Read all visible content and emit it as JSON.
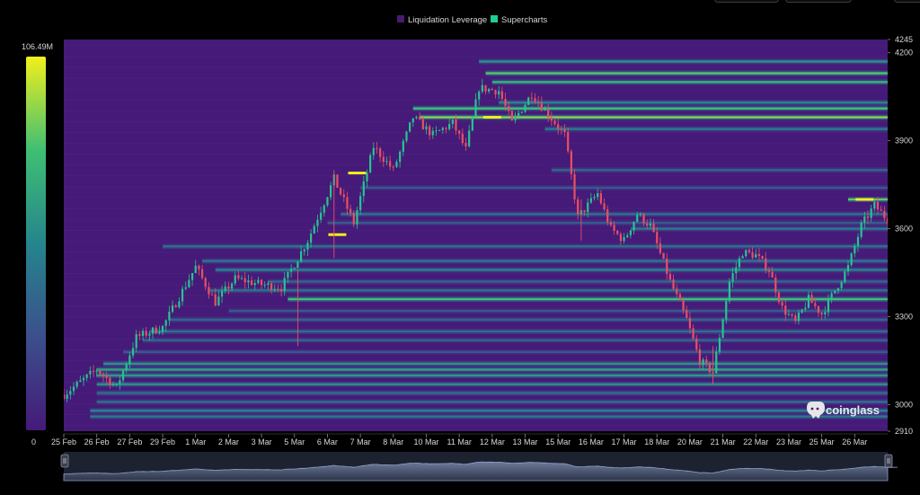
{
  "legend": [
    {
      "label": "Liquidation Leverage",
      "color": "#4a1a6e"
    },
    {
      "label": "Supercharts",
      "color": "#1fcf8f"
    }
  ],
  "colorbar": {
    "max_label": "106.49M",
    "min_label": "0"
  },
  "watermark": "coinglass",
  "colors": {
    "background": "#000000",
    "heat_base": "#451a78",
    "candle_up": "#27c48f",
    "candle_down": "#ea4f64"
  },
  "chart_data": {
    "type": "heatmap",
    "title": "",
    "xlabel": "",
    "ylabel": "",
    "ylim": [
      2910,
      4245
    ],
    "y_ticks": [
      4245,
      4200,
      3900,
      3600,
      3300,
      3000,
      2910
    ],
    "x_ticks": [
      "25 Feb",
      "26 Feb",
      "27 Feb",
      "29 Feb",
      "1 Mar",
      "2 Mar",
      "3 Mar",
      "5 Mar",
      "6 Mar",
      "7 Mar",
      "8 Mar",
      "10 Mar",
      "11 Mar",
      "12 Mar",
      "13 Mar",
      "15 Mar",
      "16 Mar",
      "17 Mar",
      "18 Mar",
      "20 Mar",
      "21 Mar",
      "22 Mar",
      "23 Mar",
      "25 Mar",
      "26 Mar"
    ],
    "colorbar_range": [
      0,
      106.49
    ],
    "colorbar_unit": "M",
    "price_path": [
      {
        "t": 0.0,
        "p": 3035
      },
      {
        "t": 1.0,
        "p": 3120
      },
      {
        "t": 1.6,
        "p": 3060
      },
      {
        "t": 2.2,
        "p": 3230
      },
      {
        "t": 3.0,
        "p": 3265
      },
      {
        "t": 4.0,
        "p": 3470
      },
      {
        "t": 4.6,
        "p": 3350
      },
      {
        "t": 5.2,
        "p": 3430
      },
      {
        "t": 6.0,
        "p": 3410
      },
      {
        "t": 6.6,
        "p": 3400
      },
      {
        "t": 7.4,
        "p": 3560
      },
      {
        "t": 8.2,
        "p": 3770
      },
      {
        "t": 8.8,
        "p": 3620
      },
      {
        "t": 9.4,
        "p": 3880
      },
      {
        "t": 10.0,
        "p": 3800
      },
      {
        "t": 10.6,
        "p": 3980
      },
      {
        "t": 11.2,
        "p": 3920
      },
      {
        "t": 11.8,
        "p": 3960
      },
      {
        "t": 12.2,
        "p": 3870
      },
      {
        "t": 12.6,
        "p": 4080
      },
      {
        "t": 13.2,
        "p": 4070
      },
      {
        "t": 13.6,
        "p": 3960
      },
      {
        "t": 14.2,
        "p": 4060
      },
      {
        "t": 14.7,
        "p": 3990
      },
      {
        "t": 15.2,
        "p": 3920
      },
      {
        "t": 15.6,
        "p": 3640
      },
      {
        "t": 16.2,
        "p": 3720
      },
      {
        "t": 16.6,
        "p": 3600
      },
      {
        "t": 17.0,
        "p": 3560
      },
      {
        "t": 17.4,
        "p": 3650
      },
      {
        "t": 17.8,
        "p": 3610
      },
      {
        "t": 18.4,
        "p": 3420
      },
      {
        "t": 18.9,
        "p": 3290
      },
      {
        "t": 19.3,
        "p": 3150
      },
      {
        "t": 19.7,
        "p": 3110
      },
      {
        "t": 20.2,
        "p": 3420
      },
      {
        "t": 20.6,
        "p": 3520
      },
      {
        "t": 21.0,
        "p": 3510
      },
      {
        "t": 21.4,
        "p": 3460
      },
      {
        "t": 21.8,
        "p": 3330
      },
      {
        "t": 22.2,
        "p": 3280
      },
      {
        "t": 22.6,
        "p": 3360
      },
      {
        "t": 23.0,
        "p": 3310
      },
      {
        "t": 23.4,
        "p": 3390
      },
      {
        "t": 23.8,
        "p": 3470
      },
      {
        "t": 24.2,
        "p": 3610
      },
      {
        "t": 24.6,
        "p": 3680
      },
      {
        "t": 25.0,
        "p": 3630
      },
      {
        "t": 25.4,
        "p": 3600
      }
    ],
    "liquidation_bands": [
      {
        "price": 4170,
        "intensity": 0.55,
        "from": 12.6
      },
      {
        "price": 4130,
        "intensity": 0.78,
        "from": 12.8
      },
      {
        "price": 4100,
        "intensity": 0.7,
        "from": 13.0
      },
      {
        "price": 4030,
        "intensity": 0.5,
        "from": 13.2
      },
      {
        "price": 4010,
        "intensity": 0.75,
        "from": 10.6
      },
      {
        "price": 3980,
        "intensity": 0.85,
        "from": 10.8
      },
      {
        "price": 3940,
        "intensity": 0.45,
        "from": 14.6
      },
      {
        "price": 3800,
        "intensity": 0.35,
        "from": 14.8
      },
      {
        "price": 3740,
        "intensity": 0.3,
        "from": 9.0
      },
      {
        "price": 3700,
        "intensity": 0.8,
        "from": 23.8
      },
      {
        "price": 3650,
        "intensity": 0.4,
        "from": 8.4
      },
      {
        "price": 3620,
        "intensity": 0.3,
        "from": 8.0
      },
      {
        "price": 3600,
        "intensity": 0.45,
        "from": 17.2
      },
      {
        "price": 3540,
        "intensity": 0.4,
        "from": 3.0
      },
      {
        "price": 3490,
        "intensity": 0.42,
        "from": 4.2
      },
      {
        "price": 3460,
        "intensity": 0.48,
        "from": 4.6
      },
      {
        "price": 3420,
        "intensity": 0.35,
        "from": 6.2
      },
      {
        "price": 3390,
        "intensity": 0.4,
        "from": 4.4
      },
      {
        "price": 3360,
        "intensity": 0.75,
        "from": 6.8
      },
      {
        "price": 3320,
        "intensity": 0.3,
        "from": 5.0
      },
      {
        "price": 3290,
        "intensity": 0.35,
        "from": 3.2
      },
      {
        "price": 3250,
        "intensity": 0.4,
        "from": 2.6
      },
      {
        "price": 3220,
        "intensity": 0.35,
        "from": 2.4
      },
      {
        "price": 3180,
        "intensity": 0.3,
        "from": 1.8
      },
      {
        "price": 3140,
        "intensity": 0.55,
        "from": 1.2
      },
      {
        "price": 3120,
        "intensity": 0.62,
        "from": 1.0
      },
      {
        "price": 3100,
        "intensity": 0.58,
        "from": 1.0
      },
      {
        "price": 3070,
        "intensity": 0.55,
        "from": 1.0
      },
      {
        "price": 3040,
        "intensity": 0.45,
        "from": 1.0
      },
      {
        "price": 3010,
        "intensity": 0.4,
        "from": 1.0
      },
      {
        "price": 2980,
        "intensity": 0.5,
        "from": 0.8
      },
      {
        "price": 2960,
        "intensity": 0.45,
        "from": 0.8
      }
    ],
    "hot_spots": [
      {
        "price": 3790,
        "t": 8.9
      },
      {
        "price": 3580,
        "t": 8.3
      },
      {
        "price": 3980,
        "t": 13.0
      },
      {
        "price": 3700,
        "t": 24.3
      }
    ]
  }
}
